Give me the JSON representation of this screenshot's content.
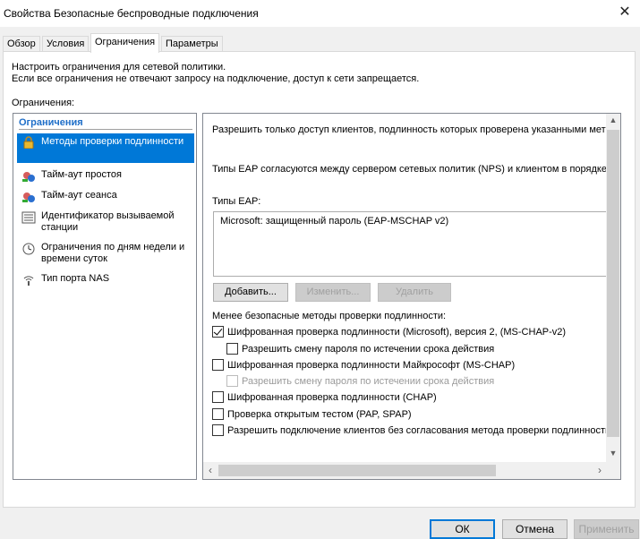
{
  "window": {
    "title": "Свойства Безопасные беспроводные подключения"
  },
  "tabs": [
    {
      "label": "Обзор"
    },
    {
      "label": "Условия"
    },
    {
      "label": "Ограничения"
    },
    {
      "label": "Параметры"
    }
  ],
  "description": {
    "line1": "Настроить ограничения для сетевой политики.",
    "line2": "Если все ограничения не отвечают запросу на подключение, доступ к сети запрещается."
  },
  "group_label": "Ограничения:",
  "left_list": {
    "header": "Ограничения",
    "items": [
      {
        "label": "Методы проверки подлинности",
        "icon": "lock-icon",
        "selected": true
      },
      {
        "label": "Тайм-аут простоя",
        "icon": "idle-timeout-icon"
      },
      {
        "label": "Тайм-аут сеанса",
        "icon": "session-timeout-icon"
      },
      {
        "label": "Идентификатор вызываемой станции",
        "icon": "station-id-icon"
      },
      {
        "label": "Ограничения по дням недели и времени суток",
        "icon": "clock-icon"
      },
      {
        "label": "Тип порта NAS",
        "icon": "nas-port-icon"
      }
    ]
  },
  "right_panel": {
    "intro": "Разрешить только доступ клиентов, подлинность которых проверена указанными методами.",
    "eap_negotiation": "Типы EAP согласуются между сервером сетевых политик (NPS) и клиентом в порядке их перечисления.",
    "eap_types_label": "Типы EAP:",
    "eap_types": [
      "Microsoft: защищенный пароль (EAP-MSCHAP v2)"
    ],
    "buttons": {
      "add": "Добавить...",
      "edit": "Изменить...",
      "remove": "Удалить"
    },
    "less_secure_label": "Менее безопасные методы проверки подлинности:",
    "options": [
      {
        "label": "Шифрованная проверка подлинности (Microsoft), версия 2, (MS-CHAP-v2)",
        "checked": true
      },
      {
        "label": "Разрешить смену пароля по истечении срока действия",
        "checked": false
      },
      {
        "label": "Шифрованная проверка подлинности Майкрософт (MS-CHAP)",
        "checked": false
      },
      {
        "label": "Разрешить смену пароля по истечении срока действия",
        "checked": false,
        "disabled": true
      },
      {
        "label": "Шифрованная проверка подлинности (CHAP)",
        "checked": false
      },
      {
        "label": "Проверка открытым тестом (PAP, SPAP)",
        "checked": false
      },
      {
        "label": "Разрешить подключение клиентов без согласования метода проверки подлинности.",
        "checked": false
      }
    ]
  },
  "footer": {
    "ok": "ОК",
    "cancel": "Отмена",
    "apply": "Применить"
  }
}
